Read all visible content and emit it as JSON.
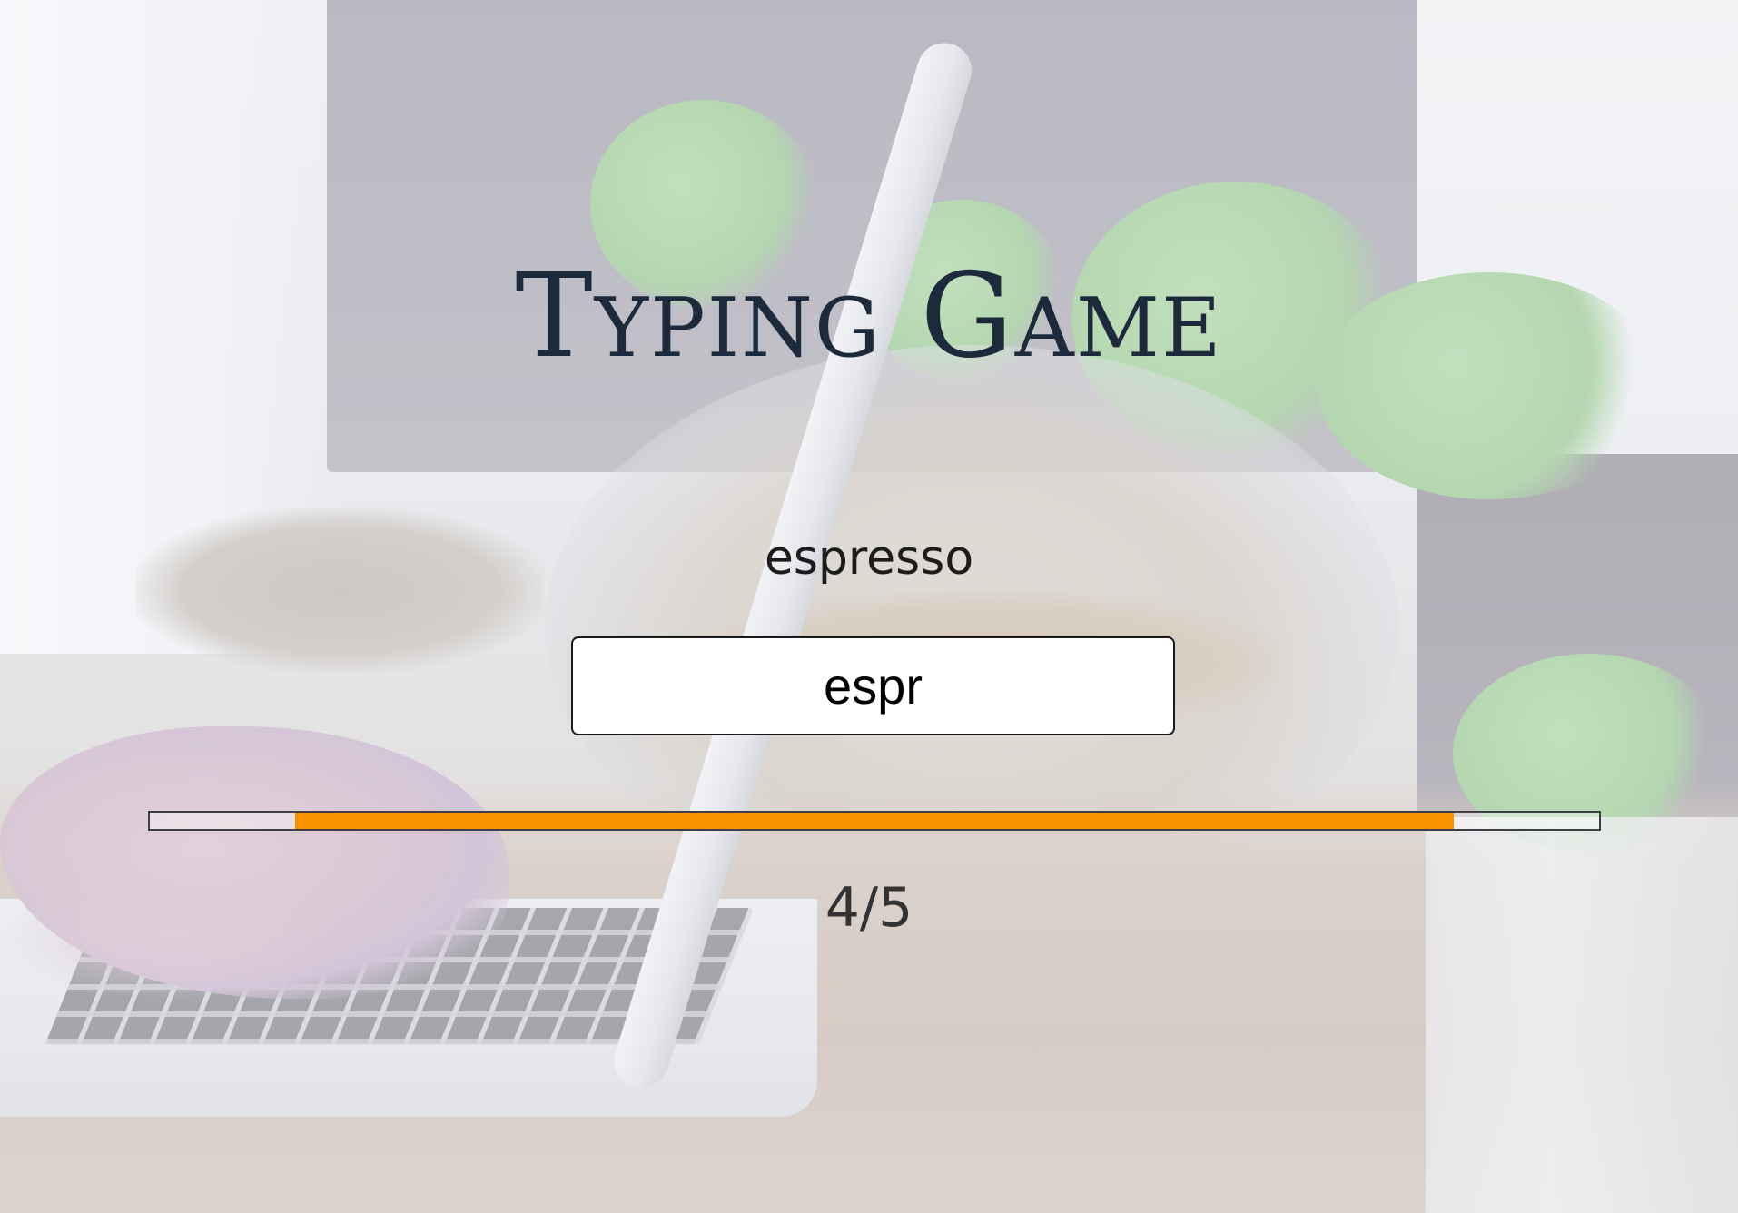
{
  "game": {
    "title": "Typing Game",
    "target_word": "espresso",
    "input_value": "espr",
    "counter": "4/5"
  },
  "progress": {
    "start_fraction": 0.1,
    "end_fraction": 0.9,
    "fill_color": "#fb9200"
  },
  "colors": {
    "title": "#1c2a3c",
    "progress_border": "#3d3f44"
  }
}
